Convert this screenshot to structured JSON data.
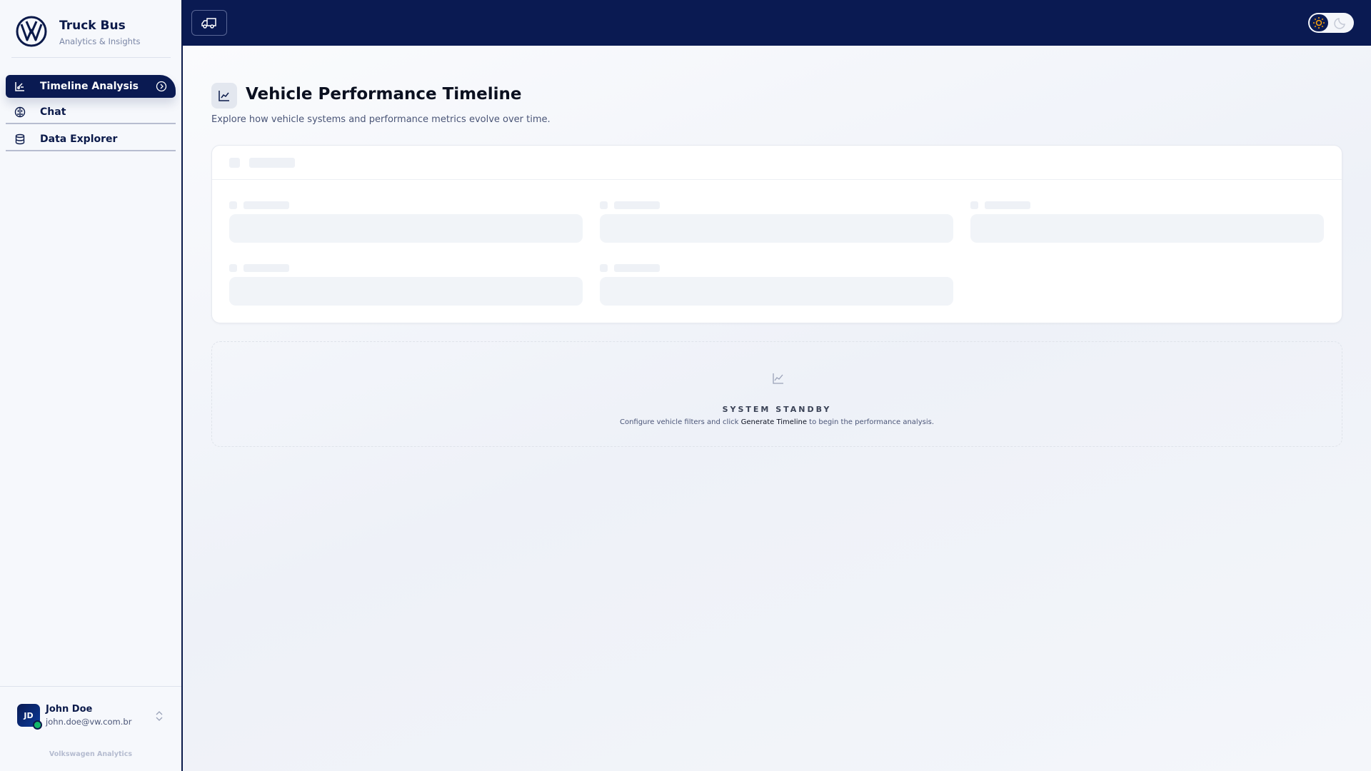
{
  "sidebar": {
    "brand": "Truck Bus",
    "brand_subtitle": "Analytics & Insights",
    "items": [
      {
        "label": "Timeline Analysis",
        "icon": "chart-scatter-icon",
        "active": true
      },
      {
        "label": "Chat",
        "icon": "brain-icon"
      },
      {
        "label": "Data Explorer",
        "icon": "database-icon"
      }
    ],
    "user": {
      "initials": "JD",
      "name": "John Doe",
      "email": "john.doe@vw.com.br",
      "status": "online"
    },
    "footer": "Volkswagen Analytics"
  },
  "header": {
    "truck_icon": "truck-icon",
    "theme": "light"
  },
  "main": {
    "title": "Vehicle Performance Timeline",
    "subtitle": "Explore how vehicle systems and performance metrics evolve over time.",
    "standby": {
      "heading": "SYSTEM STANDBY",
      "text_before": "Configure vehicle filters and click ",
      "text_link": "Generate Timeline",
      "text_after": " to begin the performance analysis."
    }
  },
  "colors": {
    "brand": "#0a1a52",
    "accent": "#f59e0b",
    "online": "#12b76a"
  }
}
